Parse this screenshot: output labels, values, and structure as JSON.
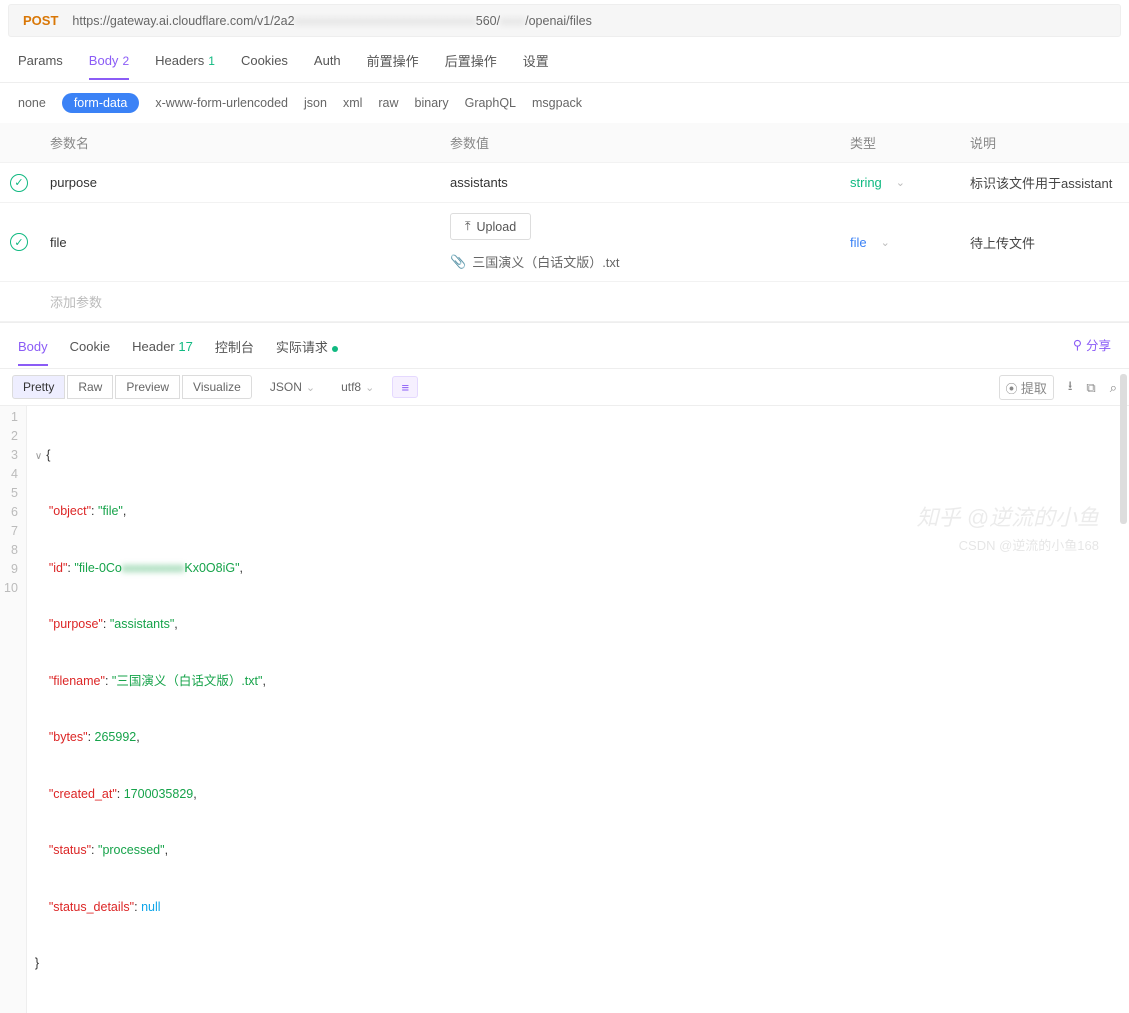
{
  "request": {
    "method": "POST",
    "url_pre": "https://gateway.ai.cloudflare.com/v1/2a2",
    "url_mid": "560/",
    "url_post": "/openai/files"
  },
  "tabs": {
    "params": "Params",
    "body": "Body",
    "body_count": "2",
    "headers": "Headers",
    "headers_count": "1",
    "cookies": "Cookies",
    "auth": "Auth",
    "pre": "前置操作",
    "post": "后置操作",
    "settings": "设置"
  },
  "body_types": {
    "none": "none",
    "form_data": "form-data",
    "xwww": "x-www-form-urlencoded",
    "json": "json",
    "xml": "xml",
    "raw": "raw",
    "binary": "binary",
    "graphql": "GraphQL",
    "msgpack": "msgpack"
  },
  "table": {
    "h_name": "参数名",
    "h_value": "参数值",
    "h_type": "类型",
    "h_desc": "说明",
    "rows": [
      {
        "key": "purpose",
        "value": "assistants",
        "type": "string",
        "desc": "标识该文件用于assistant"
      },
      {
        "key": "file",
        "upload_label": "Upload",
        "file_name": "三国演义（白话文版）.txt",
        "type": "file",
        "desc": "待上传文件"
      }
    ],
    "add": "添加参数"
  },
  "response_tabs": {
    "body": "Body",
    "cookie": "Cookie",
    "header": "Header",
    "header_count": "17",
    "console": "控制台",
    "actual": "实际请求",
    "share": "分享"
  },
  "view": {
    "pretty": "Pretty",
    "raw": "Raw",
    "preview": "Preview",
    "visualize": "Visualize",
    "format": "JSON",
    "charset": "utf8",
    "extract": "提取"
  },
  "json_body": {
    "object": "file",
    "id_pre": "file-0Co",
    "id_post": "Kx0O8iG",
    "purpose": "assistants",
    "filename": "三国演义（白话文版）.txt",
    "bytes": 265992,
    "created_at": 1700035829,
    "status": "processed",
    "status_details": null
  },
  "watermarks": {
    "zhihu": "知乎 @逆流的小鱼",
    "csdn": "CSDN @逆流的小鱼168"
  }
}
